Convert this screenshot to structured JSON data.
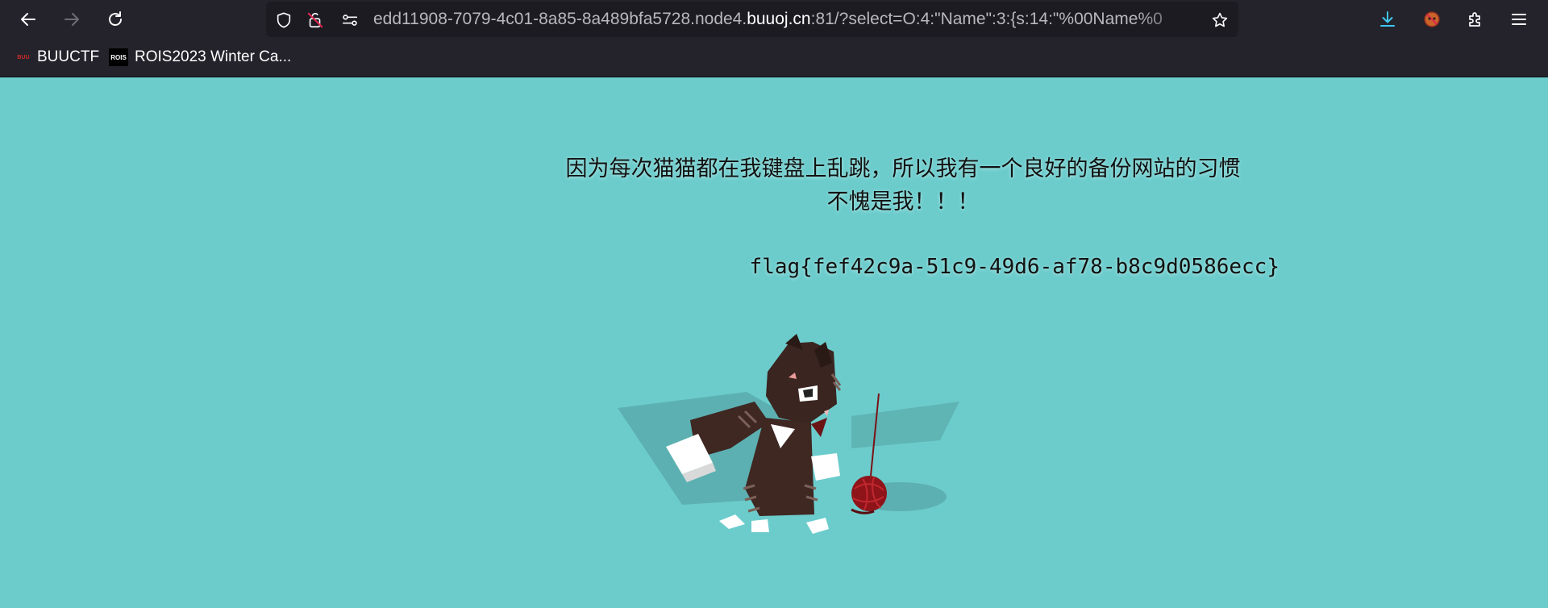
{
  "browser": {
    "url": {
      "prefix": "edd11908-7079-4c01-8a85-8a489bfa5728.node4.",
      "domain": "buuoj.cn",
      "suffix": ":81/?select=O:4:\"Name\":3:{s:14:\"%00Name%0"
    },
    "icons": {
      "back": "back-arrow-icon",
      "forward": "forward-arrow-icon",
      "reload": "reload-icon",
      "shield": "shield-icon",
      "lock": "insecure-lock-icon",
      "permissions": "permissions-icon",
      "bookmark": "star-icon",
      "downloads": "download-icon",
      "extensions": "puzzle-icon",
      "menu": "hamburger-icon"
    },
    "bookmarks": [
      {
        "label": "BUUCTF",
        "favicon": "BUU"
      },
      {
        "label": "ROIS2023 Winter Ca...",
        "favicon": "ROIS"
      }
    ]
  },
  "page": {
    "message_line1": "因为每次猫猫都在我键盘上乱跳，所以我有一个良好的备份网站的习惯",
    "message_line2": "不愧是我！！！",
    "flag": "flag{fef42c9a-51c9-49d6-af78-b8c9d0586ecc}",
    "background": "#6ccccc"
  }
}
